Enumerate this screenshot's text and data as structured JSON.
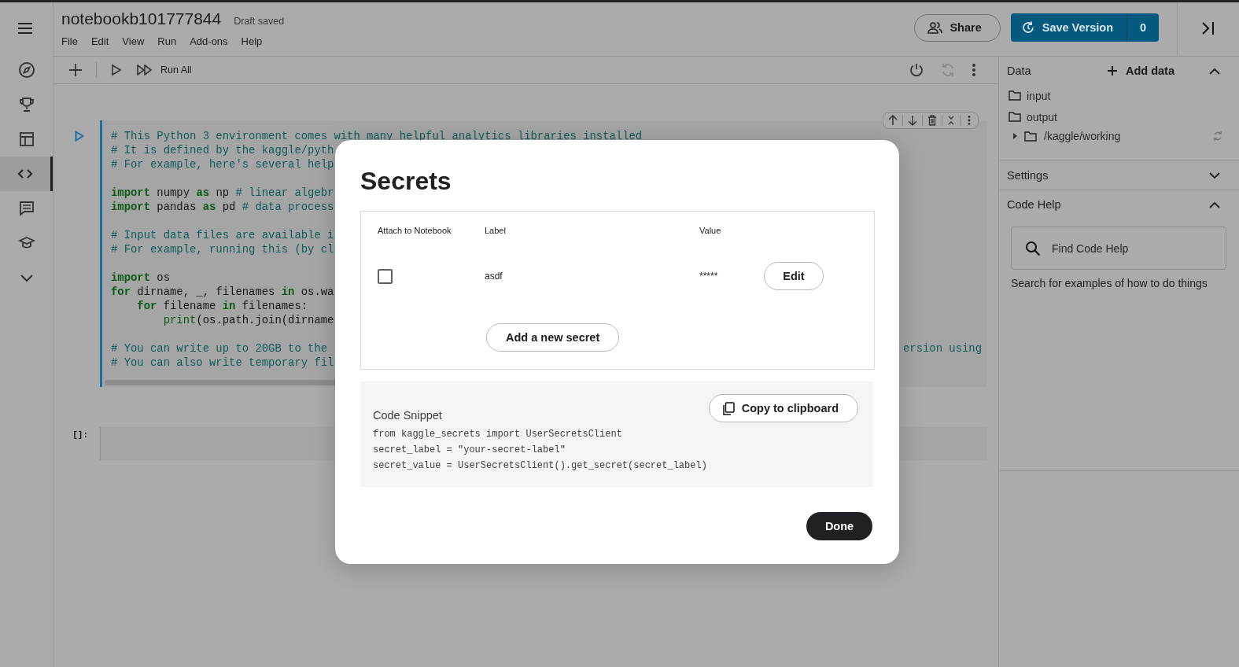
{
  "rail": {
    "items": [
      {
        "selected": false
      },
      {
        "selected": false
      },
      {
        "selected": false
      },
      {
        "selected": true
      },
      {
        "selected": false
      },
      {
        "selected": false
      },
      {
        "selected": false
      }
    ]
  },
  "header": {
    "title": "notebookb101777844",
    "status": "Draft saved",
    "menu": [
      "File",
      "Edit",
      "View",
      "Run",
      "Add-ons",
      "Help"
    ],
    "share": "Share",
    "save_version": "Save Version",
    "version_count": "0"
  },
  "toolbar": {
    "run_all": "Run All"
  },
  "cells": [
    {
      "kind": "code",
      "blocks": [
        [
          {
            "tokens": [
              {
                "text": "# This Python 3 environment comes with many helpful analytics libraries installed",
                "kind": "comment"
              }
            ]
          },
          {
            "tokens": [
              {
                "text": "# It is defined by the kaggle/pyth",
                "kind": "comment"
              }
            ]
          },
          {
            "tokens": [
              {
                "text": "# For example, here's several help",
                "kind": "comment"
              }
            ]
          }
        ],
        [
          {
            "tokens": [
              {
                "text": "import",
                "kind": "keyword"
              },
              {
                "text": " numpy ",
                "kind": "plain"
              },
              {
                "text": "as",
                "kind": "keyword"
              },
              {
                "text": " np ",
                "kind": "plain"
              },
              {
                "text": "# linear algebr",
                "kind": "comment"
              }
            ]
          },
          {
            "tokens": [
              {
                "text": "import",
                "kind": "keyword"
              },
              {
                "text": " pandas ",
                "kind": "plain"
              },
              {
                "text": "as",
                "kind": "keyword"
              },
              {
                "text": " pd ",
                "kind": "plain"
              },
              {
                "text": "# data process",
                "kind": "comment"
              }
            ]
          }
        ],
        [
          {
            "tokens": [
              {
                "text": "# Input data files are available i",
                "kind": "comment"
              }
            ]
          },
          {
            "tokens": [
              {
                "text": "# For example, running this (by cl",
                "kind": "comment"
              }
            ]
          }
        ],
        [
          {
            "tokens": [
              {
                "text": "import",
                "kind": "keyword"
              },
              {
                "text": " os",
                "kind": "plain"
              }
            ]
          },
          {
            "tokens": [
              {
                "text": "for",
                "kind": "keyword"
              },
              {
                "text": " dirname, _, filenames ",
                "kind": "plain"
              },
              {
                "text": "in",
                "kind": "keyword"
              },
              {
                "text": " os.wa",
                "kind": "plain"
              }
            ]
          },
          {
            "tokens": [
              {
                "text": "    for",
                "kind": "keyword"
              },
              {
                "text": " filename ",
                "kind": "plain"
              },
              {
                "text": "in",
                "kind": "keyword"
              },
              {
                "text": " filenames:",
                "kind": "plain"
              }
            ]
          },
          {
            "tokens": [
              {
                "text": "        print",
                "kind": "builtin"
              },
              {
                "text": "(os.path.join(dirname",
                "kind": "plain"
              }
            ]
          }
        ],
        [
          {
            "tokens": [
              {
                "text": "# You can write up to 20GB to the ",
                "kind": "comment"
              }
            ],
            "right_fragment": "ersion using"
          },
          {
            "tokens": [
              {
                "text": "# You can also write temporary fil",
                "kind": "comment"
              }
            ]
          }
        ]
      ]
    },
    {
      "kind": "empty",
      "prompt": "[]:"
    }
  ],
  "right_panel": {
    "sections": [
      {
        "kind": "data",
        "title": "Data",
        "action": "Add data",
        "expanded": true,
        "tree": [
          {
            "name": "input",
            "expanded": false
          },
          {
            "name": "output",
            "expanded": true,
            "children": [
              {
                "name": "/kaggle/working",
                "expanded": false
              }
            ]
          }
        ]
      },
      {
        "kind": "plain",
        "title": "Settings",
        "expanded": false
      },
      {
        "kind": "search",
        "title": "Code Help",
        "expanded": true,
        "placeholder": "Find Code Help",
        "hint": "Search for examples of how to do things"
      }
    ]
  },
  "dialog": {
    "title": "Secrets",
    "columns": [
      "Attach to Notebook",
      "Label",
      "Value"
    ],
    "rows": [
      {
        "checked": false,
        "label": "asdf",
        "value": "*****",
        "action": "Edit"
      }
    ],
    "add_button": "Add a new secret",
    "snippet": {
      "title": "Code Snippet",
      "copy_button": "Copy to clipboard",
      "lines": [
        "from kaggle_secrets import UserSecretsClient",
        "secret_label = \"your-secret-label\"",
        "secret_value = UserSecretsClient().get_secret(secret_label)"
      ]
    },
    "done": "Done"
  }
}
